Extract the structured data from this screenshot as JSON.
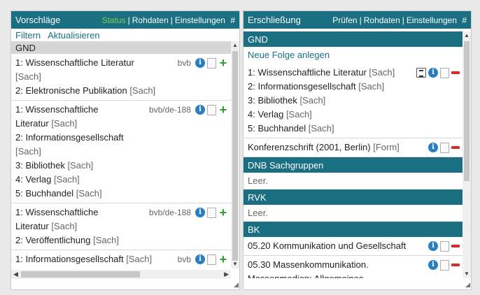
{
  "left": {
    "title": "Vorschläge",
    "links": [
      "Status",
      "Rohdaten",
      "Einstellungen"
    ],
    "hash": "#",
    "toolbar": {
      "filter": "Filtern",
      "refresh": "Aktualisieren"
    },
    "group": "GND",
    "rows": [
      {
        "source": "bvb",
        "lines": [
          {
            "main": "1: Wissenschaftliche Literatur",
            "sub": ""
          },
          {
            "main": "",
            "sub": "[Sach]"
          },
          {
            "main": "2: Elektronische Publikation ",
            "sub": "[Sach]"
          }
        ]
      },
      {
        "source": "bvb/de-188",
        "lines": [
          {
            "main": "1: Wissenschaftliche",
            "sub": ""
          },
          {
            "main": "Literatur ",
            "sub": "[Sach]"
          },
          {
            "main": "2: Informationsgesellschaft",
            "sub": ""
          },
          {
            "main": "",
            "sub": "[Sach]"
          },
          {
            "main": "3: Bibliothek ",
            "sub": "[Sach]"
          },
          {
            "main": "4: Verlag ",
            "sub": "[Sach]"
          },
          {
            "main": "5: Buchhandel ",
            "sub": "[Sach]"
          }
        ]
      },
      {
        "source": "bvb/de-188",
        "lines": [
          {
            "main": "1: Wissenschaftliche",
            "sub": ""
          },
          {
            "main": "Literatur ",
            "sub": "[Sach]"
          },
          {
            "main": "2: Veröffentlichung ",
            "sub": "[Sach]"
          }
        ]
      },
      {
        "source": "bvb",
        "lines": [
          {
            "main": "1: Informationsgesellschaft ",
            "sub": "[Sach]"
          }
        ]
      }
    ]
  },
  "right": {
    "title": "Erschließung",
    "links": [
      "Prüfen",
      "Rohdaten",
      "Einstellungen"
    ],
    "hash": "#",
    "gnd_label": "GND",
    "new_sequence": "Neue Folge anlegen",
    "gnd_entries": [
      {
        "lines": [
          {
            "main": "1: Wissenschaftliche Literatur ",
            "sub": "[Sach]"
          },
          {
            "main": "2: Informationsgesellschaft ",
            "sub": "[Sach]"
          },
          {
            "main": "3: Bibliothek ",
            "sub": "[Sach]"
          },
          {
            "main": "4: Verlag ",
            "sub": "[Sach]"
          },
          {
            "main": "5: Buchhandel ",
            "sub": "[Sach]"
          }
        ],
        "edit": true
      },
      {
        "lines": [
          {
            "main": "Konferenzschrift (2001, Berlin) ",
            "sub": "[Form]"
          }
        ],
        "edit": false
      }
    ],
    "dnb_label": "DNB Sachgruppen",
    "dnb_empty": "Leer.",
    "rvk_label": "RVK",
    "rvk_empty": "Leer.",
    "bk_label": "BK",
    "bk_entries": [
      {
        "lines": [
          {
            "main": "05.20 Kommunikation und Gesellschaft",
            "sub": ""
          }
        ]
      },
      {
        "lines": [
          {
            "main": "05.30 Massenkommunikation.",
            "sub": ""
          },
          {
            "main": "Massenmedien: Allgemeines",
            "sub": ""
          }
        ]
      }
    ]
  },
  "colors": {
    "header": "#1a6f83",
    "status": "#7fd24a",
    "add": "#2aa12a",
    "remove": "#d62b2b",
    "info": "#2a7fc1"
  },
  "icons": {
    "info": "info-icon",
    "copy": "copy-icon",
    "add": "add-icon",
    "remove": "remove-icon",
    "edit": "edit-icon"
  }
}
